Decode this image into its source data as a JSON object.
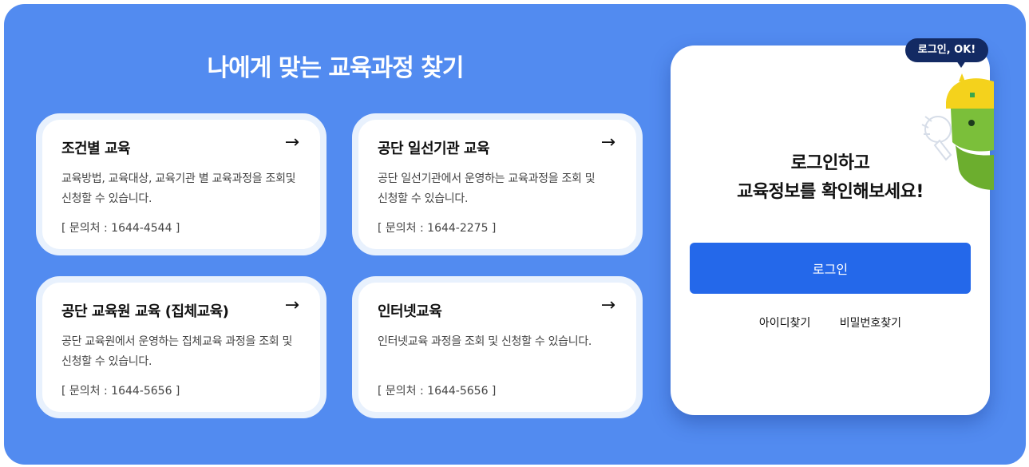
{
  "section": {
    "title": "나에게 맞는 교육과정 찾기"
  },
  "cards": [
    {
      "title": "조건별 교육",
      "arrow": "→",
      "description": "교육방법, 교육대상, 교육기관 별 교육과정을 조회및 신청할 수 있습니다.",
      "contact": "[ 문의처 : 1644-4544 ]"
    },
    {
      "title": "공단 일선기관 교육",
      "arrow": "→",
      "description": "공단 일선기관에서 운영하는 교육과정을 조회 및 신청할 수 있습니다.",
      "contact": "[ 문의처 : 1644-2275 ]"
    },
    {
      "title": "공단 교육원 교육 (집체교육)",
      "arrow": "→",
      "description": "공단 교육원에서 운영하는 집체교육 과정을 조회 및 신청할 수 있습니다.",
      "contact": "[ 문의처 : 1644-5656 ]"
    },
    {
      "title": "인터넷교육",
      "arrow": "→",
      "description": "인터넷교육 과정을 조회 및 신청할 수 있습니다.",
      "contact": "[ 문의처 : 1644-5656 ]"
    }
  ],
  "login": {
    "bubble": "로그인, OK!",
    "heading_line1": "로그인하고",
    "heading_line2": "교육정보를 확인해보세요!",
    "button_label": "로그인",
    "find_id": "아이디찾기",
    "find_password": "비밀번호찾기"
  },
  "colors": {
    "panel": "#528bf0",
    "card_border": "#e8f1fd",
    "login_button": "#2468ea",
    "bubble": "#132a63"
  },
  "icons": {
    "card_arrow": "arrow-right-icon",
    "mascot": "mascot-character-icon"
  }
}
